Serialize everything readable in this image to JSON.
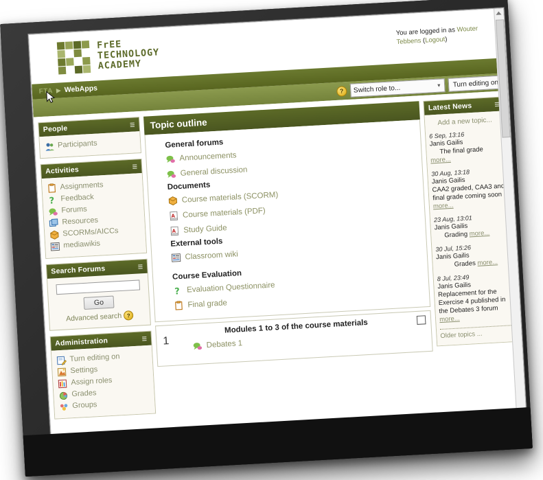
{
  "site": {
    "logo_text_lines": [
      "FrEE",
      "TECHNOLOGY",
      "ACADEMY"
    ],
    "logo_colors": [
      "#6d7a2e",
      "#8d9a4c",
      "#aab66e",
      "#5c6a27",
      "#7f8c40",
      "#9aa85a"
    ]
  },
  "login": {
    "prefix": "You are logged in as ",
    "user": "Wouter Tebbens",
    "logout_open": " (",
    "logout": "Logout",
    "logout_close": ")"
  },
  "breadcrumb": {
    "root": "FTA",
    "separator": "▶",
    "current": "WebApps"
  },
  "rolebar": {
    "help_icon_label": "?",
    "switch_role": "Switch role to...",
    "chevron": "▼",
    "turn_editing_on": "Turn editing on"
  },
  "blocks": {
    "people": {
      "title": "People",
      "items": [
        {
          "label": "Participants",
          "icon": "people-icon"
        }
      ]
    },
    "activities": {
      "title": "Activities",
      "items": [
        {
          "label": "Assignments",
          "icon": "clipboard-icon"
        },
        {
          "label": "Feedback",
          "icon": "question-mark-icon"
        },
        {
          "label": "Forums",
          "icon": "forum-bubble-icon"
        },
        {
          "label": "Resources",
          "icon": "window-icon"
        },
        {
          "label": "SCORMs/AICCs",
          "icon": "package-icon"
        },
        {
          "label": "mediawikis",
          "icon": "wiki-icon"
        }
      ]
    },
    "search_forums": {
      "title": "Search Forums",
      "input_value": "",
      "input_placeholder": "",
      "go_label": "Go",
      "advanced_label": "Advanced search",
      "help_icon_label": "?"
    },
    "administration": {
      "title": "Administration",
      "items": [
        {
          "label": "Turn editing on",
          "icon": "pencil-edit-icon"
        },
        {
          "label": "Settings",
          "icon": "settings-icon"
        },
        {
          "label": "Assign roles",
          "icon": "assign-roles-icon"
        },
        {
          "label": "Grades",
          "icon": "grades-icon"
        },
        {
          "label": "Groups",
          "icon": "groups-icon"
        }
      ]
    },
    "latest_news": {
      "title": "Latest News",
      "add_topic": "Add a new topic...",
      "older_topics": "Older topics ...",
      "more_label": "more...",
      "items": [
        {
          "date": "6 Sep, 13:16",
          "author": "Janis Gailis",
          "subject": "The final grade"
        },
        {
          "date": "30 Aug, 13:18",
          "author": "Janis Gailis",
          "subject": "CAA2 graded, CAA3 and final grade coming soon"
        },
        {
          "date": "23 Aug, 13:01",
          "author": "Janis Gailis",
          "subject": "Grading"
        },
        {
          "date": "30 Jul, 15:26",
          "author": "Janis Gailis",
          "subject": "Grades"
        },
        {
          "date": "8 Jul, 23:49",
          "author": "Janis Gailis",
          "subject": "Replacement for the Exercise 4 published in the Debates 3 forum"
        }
      ]
    }
  },
  "main": {
    "title": "Topic outline",
    "sections": [
      {
        "heading": "General forums",
        "items": [
          {
            "label": "Announcements",
            "icon": "forum-bubble-icon"
          },
          {
            "label": "General discussion",
            "icon": "forum-bubble-icon"
          }
        ]
      },
      {
        "heading": "Documents",
        "items": [
          {
            "label": "Course materials (SCORM)",
            "icon": "package-icon"
          },
          {
            "label": "Course materials (PDF)",
            "icon": "pdf-icon"
          },
          {
            "label": "Study Guide",
            "icon": "pdf-icon"
          }
        ]
      },
      {
        "heading": "External tools",
        "items": [
          {
            "label": "Classroom wiki",
            "icon": "wiki-icon"
          }
        ]
      },
      {
        "heading": "Course Evaluation",
        "items": [
          {
            "label": "Evaluation Questionnaire",
            "icon": "question-mark-icon"
          },
          {
            "label": "Final grade",
            "icon": "clipboard-icon"
          }
        ]
      }
    ],
    "topic": {
      "number": "1",
      "caption": "Modules 1 to 3 of the course materials",
      "items": [
        {
          "label": "Debates 1",
          "icon": "forum-bubble-icon"
        }
      ]
    }
  },
  "colors": {
    "header_green": "#4e5b22",
    "bar_green": "#74833b",
    "link_olive": "#8c9163",
    "block_bg": "#faf8f2",
    "block_border": "#c5c5ab"
  }
}
